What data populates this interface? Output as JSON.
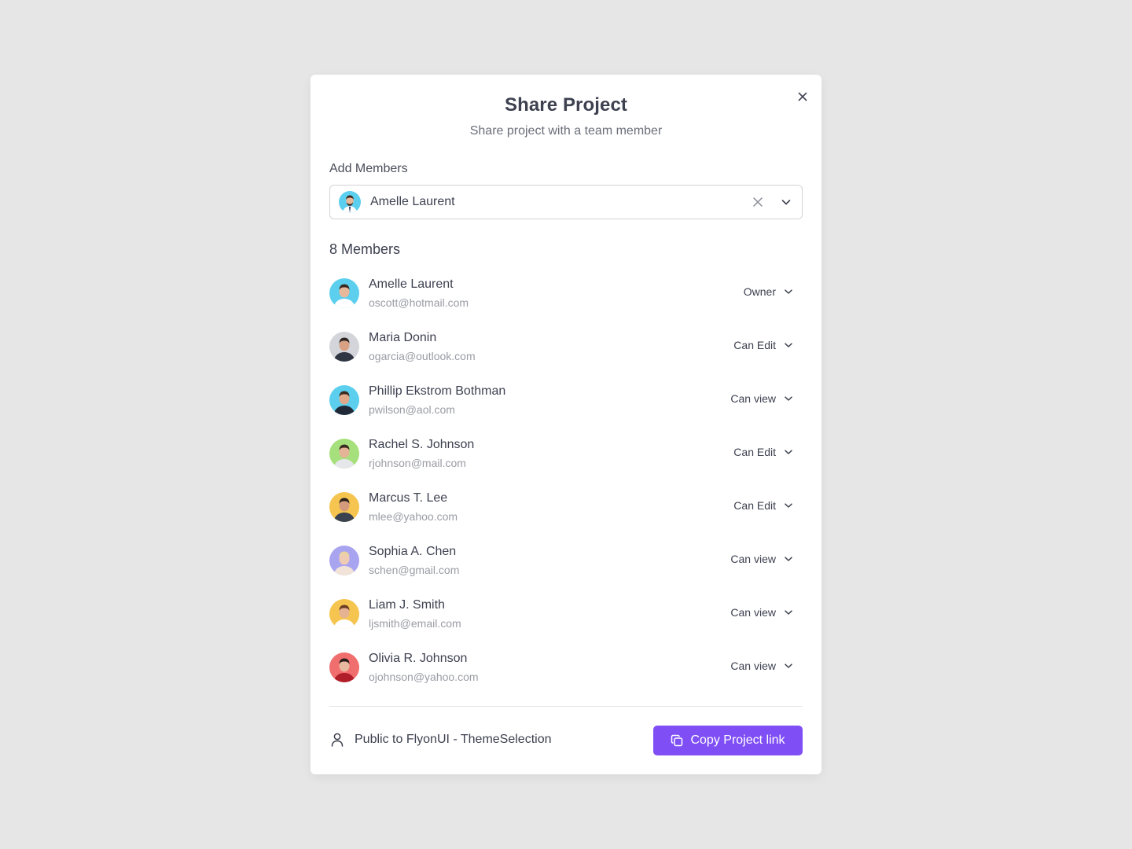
{
  "dialog": {
    "title": "Share Project",
    "subtitle": "Share project with a team member",
    "close_icon": "close-icon"
  },
  "add_members": {
    "label": "Add Members",
    "selected": {
      "name": "Amelle Laurent",
      "avatar_color": "#5ccfee"
    },
    "clear_icon": "close-icon",
    "dropdown_icon": "chevron-down-icon"
  },
  "members_heading": "8 Members",
  "members": [
    {
      "name": "Amelle Laurent",
      "email": "oscott@hotmail.com",
      "role": "Owner",
      "avatar_bg": "#5ccfee",
      "skin": "#e8b89a",
      "hair": "#3b2a22",
      "shirt": "#ffffff"
    },
    {
      "name": "Maria Donin",
      "email": "ogarcia@outlook.com",
      "role": "Can Edit",
      "avatar_bg": "#d3d5db",
      "skin": "#d9a184",
      "hair": "#2e2622",
      "shirt": "#2f3542"
    },
    {
      "name": "Phillip Ekstrom Bothman",
      "email": "pwilson@aol.com",
      "role": "Can view",
      "avatar_bg": "#5ccfee",
      "skin": "#e0a98a",
      "hair": "#3a2a20",
      "shirt": "#1f2937"
    },
    {
      "name": "Rachel S. Johnson",
      "email": "rjohnson@mail.com",
      "role": "Can Edit",
      "avatar_bg": "#a6e07c",
      "skin": "#e4b497",
      "hair": "#3b2a1f",
      "shirt": "#e6e7ea"
    },
    {
      "name": "Marcus T. Lee",
      "email": "mlee@yahoo.com",
      "role": "Can Edit",
      "avatar_bg": "#f6c54f",
      "skin": "#d39b7c",
      "hair": "#2a211d",
      "shirt": "#39424e"
    },
    {
      "name": "Sophia A. Chen",
      "email": "schen@gmail.com",
      "role": "Can view",
      "avatar_bg": "#a9a4f0",
      "skin": "#efcbb4",
      "hair": "#e9d3a1",
      "shirt": "#f1e3d7"
    },
    {
      "name": "Liam J. Smith",
      "email": "ljsmith@email.com",
      "role": "Can view",
      "avatar_bg": "#f6c54f",
      "skin": "#e6b392",
      "hair": "#6b3d24",
      "shirt": "#ffffff"
    },
    {
      "name": "Olivia R. Johnson",
      "email": "ojohnson@yahoo.com",
      "role": "Can view",
      "avatar_bg": "#f06e6e",
      "skin": "#e9b8a0",
      "hair": "#2b1d19",
      "shirt": "#b01e2a"
    }
  ],
  "footer": {
    "visibility_text": "Public to FlyonUI - ThemeSelection",
    "visibility_icon": "user-icon",
    "copy_button_label": "Copy Project link",
    "copy_icon": "copy-icon",
    "accent_color": "#7f4ff5"
  }
}
